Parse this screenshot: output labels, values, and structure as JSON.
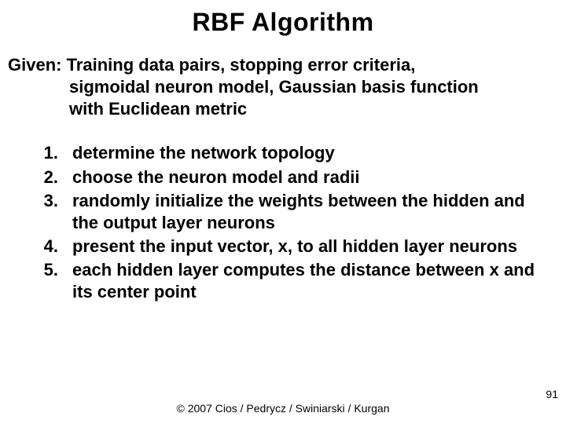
{
  "title": "RBF Algorithm",
  "given": {
    "label": "Given: ",
    "line1": "Training data pairs, stopping error criteria,",
    "line2": "sigmoidal neuron model, Gaussian basis function",
    "line3": "with Euclidean metric"
  },
  "steps": [
    {
      "num": "1.",
      "text": "determine the network topology"
    },
    {
      "num": "2.",
      "text": "choose the neuron model and radii"
    },
    {
      "num": "3.",
      "text": "randomly initialize the weights between the hidden and the output layer neurons"
    },
    {
      "num": "4.",
      "text": "present the input vector, x, to all hidden layer neurons"
    },
    {
      "num": "5.",
      "text": "each hidden layer computes the distance between x and its center point"
    }
  ],
  "footer": "© 2007 Cios / Pedrycz / Swiniarski / Kurgan",
  "pagenum": "91"
}
